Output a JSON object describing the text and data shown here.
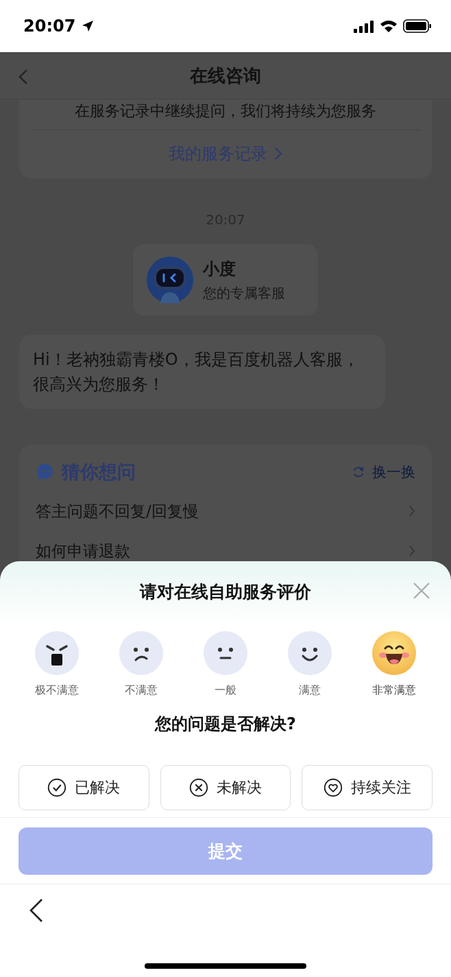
{
  "status_bar": {
    "time": "20:07"
  },
  "header": {
    "title": "在线咨询"
  },
  "record_card": {
    "text": "在服务记录中继续提问，我们将持续为您服务",
    "link": "我的服务记录"
  },
  "timestamp": "20:07",
  "bot_card": {
    "name": "小度",
    "subtitle": "您的专属客服"
  },
  "message": "Hi！老衲独霸青楼O，我是百度机器人客服，很高兴为您服务！",
  "suggestions": {
    "title": "猜你想问",
    "refresh": "换一换",
    "items": [
      "答主问题不回复/回复慢",
      "如何申请退款"
    ]
  },
  "rating_sheet": {
    "title": "请对在线自助服务评价",
    "ratings": [
      {
        "kind": "angry",
        "label": "极不满意",
        "selected": false
      },
      {
        "kind": "sad",
        "label": "不满意",
        "selected": false
      },
      {
        "kind": "neutral",
        "label": "一般",
        "selected": false
      },
      {
        "kind": "smile",
        "label": "满意",
        "selected": false
      },
      {
        "kind": "laugh",
        "label": "非常满意",
        "selected": true
      }
    ],
    "question": "您的问题是否解决?",
    "options": [
      {
        "kind": "check",
        "label": "已解决",
        "selected": false
      },
      {
        "kind": "cross",
        "label": "未解决",
        "selected": false
      },
      {
        "kind": "heart",
        "label": "持续关注",
        "selected": false
      }
    ],
    "submit": {
      "label": "提交",
      "disabled": true
    }
  }
}
